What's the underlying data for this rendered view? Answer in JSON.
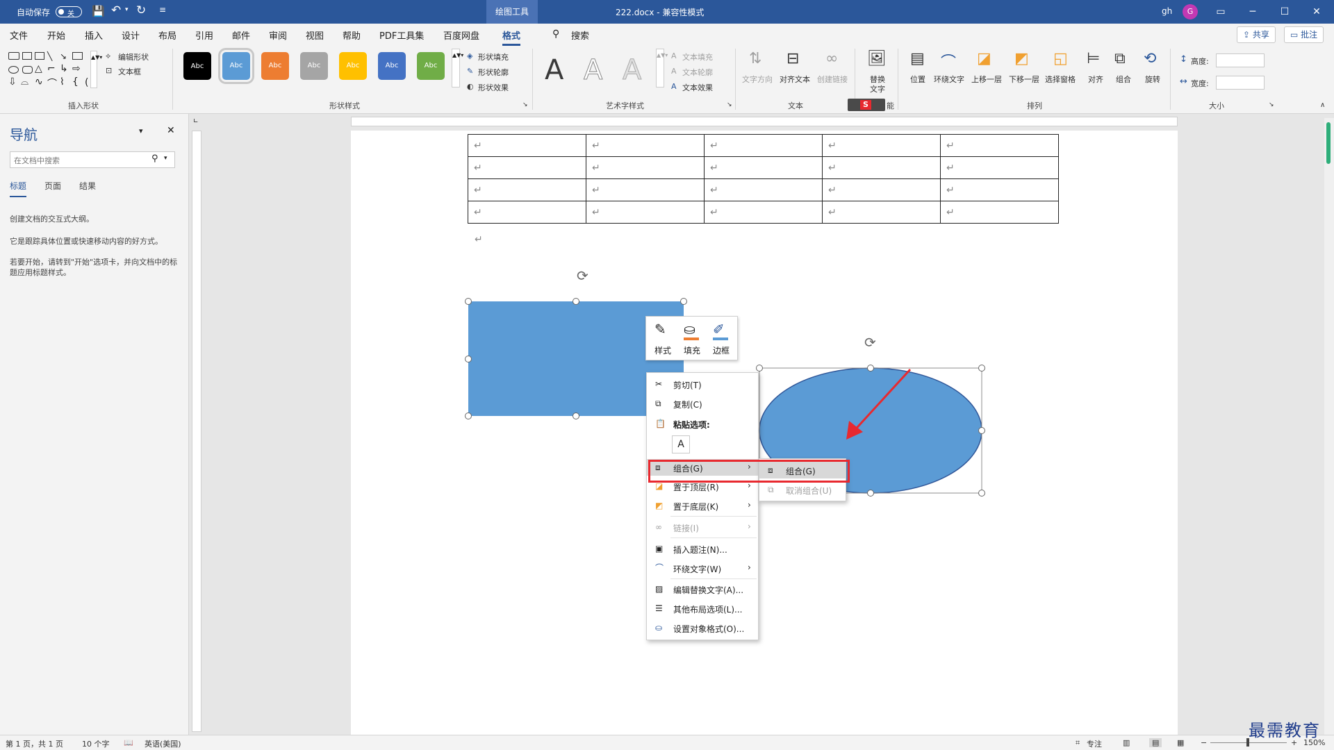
{
  "titlebar": {
    "autosave_label": "自动保存",
    "autosave_state": "关",
    "context_tab": "绘图工具",
    "doc_title": "222.docx - 兼容性模式",
    "user": "gh",
    "avatar_initial": "G"
  },
  "menu": {
    "tabs": [
      "文件",
      "开始",
      "插入",
      "设计",
      "布局",
      "引用",
      "邮件",
      "审阅",
      "视图",
      "帮助",
      "PDF工具集",
      "百度网盘",
      "格式"
    ],
    "active_tab": "格式",
    "search": "搜索",
    "share": "共享",
    "comments": "批注"
  },
  "ribbon": {
    "insert_shapes": {
      "edit_shape": "编辑形状",
      "text_box": "文本框",
      "label": "插入形状"
    },
    "shape_styles": {
      "swatches": [
        {
          "label": "Abc",
          "color": "#000000"
        },
        {
          "label": "Abc",
          "color": "#5b9bd5"
        },
        {
          "label": "Abc",
          "color": "#ed7d31"
        },
        {
          "label": "Abc",
          "color": "#a5a5a5"
        },
        {
          "label": "Abc",
          "color": "#ffc000"
        },
        {
          "label": "Abc",
          "color": "#4472c4"
        },
        {
          "label": "Abc",
          "color": "#70ad47"
        }
      ],
      "fill": "形状填充",
      "outline": "形状轮廓",
      "effects": "形状效果",
      "label": "形状样式"
    },
    "wordart": {
      "fill": "文本填充",
      "outline": "文本轮廓",
      "effects": "文本效果",
      "label": "艺术字样式",
      "glyph": "A"
    },
    "text": {
      "direction": "文字方向",
      "align": "对齐文本",
      "link": "创建链接",
      "label": "文本"
    },
    "alt_text": {
      "line1": "替换",
      "line2": "文字",
      "label_tail": "能"
    },
    "arrange": {
      "position": "位置",
      "wrap": "环绕文字",
      "forward": "上移一层",
      "backward": "下移一层",
      "pane": "选择窗格",
      "align": "对齐",
      "group": "组合",
      "rotate": "旋转",
      "label": "排列"
    },
    "size": {
      "height": "高度:",
      "width": "宽度:",
      "label": "大小"
    }
  },
  "nav": {
    "title": "导航",
    "search_placeholder": "在文档中搜索",
    "tabs": [
      "标题",
      "页面",
      "结果"
    ],
    "text1": "创建文档的交互式大纲。",
    "text2": "它是跟踪具体位置或快速移动内容的好方式。",
    "text3": "若要开始，请转到\"开始\"选项卡，并向文档中的标题应用标题样式。"
  },
  "document": {
    "para_mark": "↵",
    "rows": 4,
    "cols": 5,
    "rect_color": "#5b9bd5",
    "ellipse_color": "#5b9bd5",
    "arrow_color": "#e8292f"
  },
  "mini_toolbar": {
    "style": "样式",
    "fill": "填充",
    "border": "边框"
  },
  "context_menu": {
    "items": [
      {
        "label": "剪切(T)",
        "icon": "scissors-icon"
      },
      {
        "label": "复制(C)",
        "icon": "copy-icon"
      },
      {
        "label": "粘贴选项:",
        "icon": "paste-icon"
      },
      {
        "label": "组合(G)",
        "icon": "group-icon",
        "submenu": true,
        "highlighted": true
      },
      {
        "label": "置于顶层(R)",
        "icon": "bring-front-icon",
        "submenu": true
      },
      {
        "label": "置于底层(K)",
        "icon": "send-back-icon",
        "submenu": true
      },
      {
        "label": "链接(I)",
        "icon": "link-icon",
        "submenu": true,
        "disabled": true
      },
      {
        "label": "插入题注(N)...",
        "icon": "caption-icon"
      },
      {
        "label": "环绕文字(W)",
        "icon": "wrap-icon",
        "submenu": true
      },
      {
        "label": "编辑替换文字(A)...",
        "icon": "alt-text-icon"
      },
      {
        "label": "其他布局选项(L)...",
        "icon": "layout-icon"
      },
      {
        "label": "设置对象格式(O)...",
        "icon": "format-icon"
      }
    ],
    "submenu": [
      {
        "label": "组合(G)",
        "disabled": false
      },
      {
        "label": "取消组合(U)",
        "disabled": true
      }
    ]
  },
  "status": {
    "page": "第 1 页，共 1 页",
    "words": "10 个字",
    "language": "英语(美国)",
    "focus": "专注",
    "zoom": "150%"
  },
  "watermark": "最需教育"
}
